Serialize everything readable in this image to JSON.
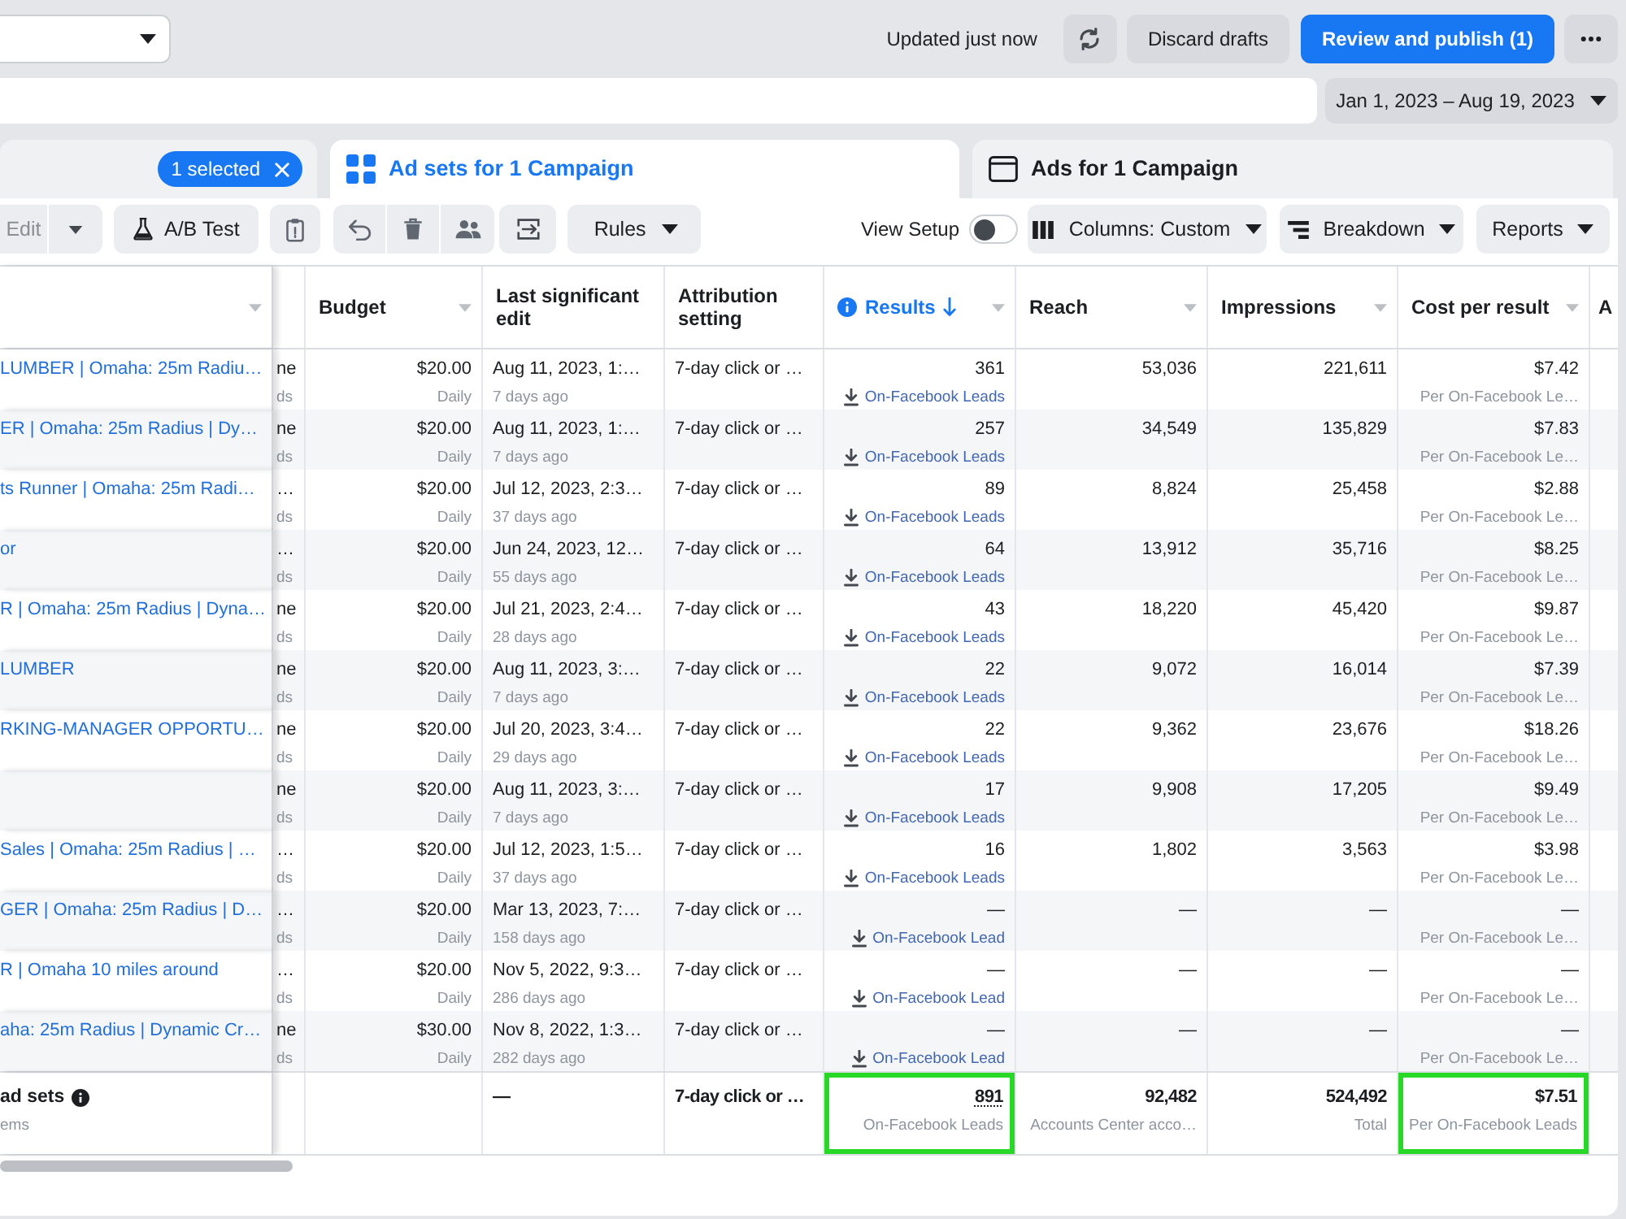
{
  "top_bar": {
    "status": "Updated just now",
    "discard_button": "Discard drafts",
    "publish_button": "Review and publish (1)"
  },
  "filter_bar": {
    "date_range": "Jan 1, 2023 – Aug 19, 2023"
  },
  "tabs": [
    {
      "badge": "1 selected",
      "selected": false
    },
    {
      "label": "Ad sets for 1 Campaign",
      "selected": true
    },
    {
      "label": "Ads for 1 Campaign",
      "selected": false
    }
  ],
  "toolbar": {
    "edit_button": {
      "label": "Edit",
      "disabled": true
    },
    "ab_test_button": "A/B Test",
    "rules_button": "Rules",
    "view_setup": {
      "label": "View Setup",
      "on": false
    },
    "columns_button": "Columns: Custom",
    "breakdown_button": "Breakdown",
    "reports_button": "Reports"
  },
  "table": {
    "columns": [
      {
        "sortable": true,
        "sorted": false
      },
      {
        "sortable": false,
        "sorted": false
      },
      {
        "label": "Budget",
        "sortable": true,
        "sorted": false
      },
      {
        "label": "Last significant edit",
        "sortable": false,
        "sorted": false
      },
      {
        "label": "Attribution setting",
        "sortable": false,
        "sorted": false
      },
      {
        "label": "Results",
        "info": true,
        "sortable": true,
        "sorted": true
      },
      {
        "label": "Reach",
        "sortable": true,
        "sorted": false
      },
      {
        "label": "Impressions",
        "sortable": true,
        "sorted": false
      },
      {
        "label": "Cost per result",
        "sortable": true,
        "sorted": false
      },
      {
        "label": "A",
        "sortable": false,
        "sorted": false
      }
    ],
    "rows": [
      {
        "name": "LUMBER | Omaha: 25m Radiu…",
        "column_2": {
          "value": "ne",
          "sub": "ds"
        },
        "budget": {
          "value": "$20.00",
          "sub": "Daily"
        },
        "last_edit": {
          "value": "Aug 11, 2023, 1:…",
          "sub": "7 days ago"
        },
        "attribution": "7-day click or …",
        "results": {
          "value": "361",
          "sub": "On-Facebook Leads"
        },
        "reach": "53,036",
        "impressions": "221,611",
        "cost_per_result": {
          "value": "$7.42",
          "sub": "Per On-Facebook Le…"
        }
      },
      {
        "name": "ER | Omaha: 25m Radius | Dy…",
        "column_2": {
          "value": "ne",
          "sub": "ds"
        },
        "budget": {
          "value": "$20.00",
          "sub": "Daily"
        },
        "last_edit": {
          "value": "Aug 11, 2023, 1:…",
          "sub": "7 days ago"
        },
        "attribution": "7-day click or …",
        "results": {
          "value": "257",
          "sub": "On-Facebook Leads"
        },
        "reach": "34,549",
        "impressions": "135,829",
        "cost_per_result": {
          "value": "$7.83",
          "sub": "Per On-Facebook Le…"
        }
      },
      {
        "name": "ts Runner | Omaha: 25m Radi…",
        "column_2": {
          "value": "…",
          "sub": "ds"
        },
        "budget": {
          "value": "$20.00",
          "sub": "Daily"
        },
        "last_edit": {
          "value": "Jul 12, 2023, 2:3…",
          "sub": "37 days ago"
        },
        "attribution": "7-day click or …",
        "results": {
          "value": "89",
          "sub": "On-Facebook Leads"
        },
        "reach": "8,824",
        "impressions": "25,458",
        "cost_per_result": {
          "value": "$2.88",
          "sub": "Per On-Facebook Le…"
        }
      },
      {
        "name": "or",
        "column_2": {
          "value": "…",
          "sub": "ds"
        },
        "budget": {
          "value": "$20.00",
          "sub": "Daily"
        },
        "last_edit": {
          "value": "Jun 24, 2023, 12…",
          "sub": "55 days ago"
        },
        "attribution": "7-day click or …",
        "results": {
          "value": "64",
          "sub": "On-Facebook Leads"
        },
        "reach": "13,912",
        "impressions": "35,716",
        "cost_per_result": {
          "value": "$8.25",
          "sub": "Per On-Facebook Le…"
        }
      },
      {
        "name": "R | Omaha: 25m Radius | Dyna…",
        "column_2": {
          "value": "ne",
          "sub": "ds"
        },
        "budget": {
          "value": "$20.00",
          "sub": "Daily"
        },
        "last_edit": {
          "value": "Jul 21, 2023, 2:4…",
          "sub": "28 days ago"
        },
        "attribution": "7-day click or …",
        "results": {
          "value": "43",
          "sub": "On-Facebook Leads"
        },
        "reach": "18,220",
        "impressions": "45,420",
        "cost_per_result": {
          "value": "$9.87",
          "sub": "Per On-Facebook Le…"
        }
      },
      {
        "name": "LUMBER",
        "column_2": {
          "value": "ne",
          "sub": "ds"
        },
        "budget": {
          "value": "$20.00",
          "sub": "Daily"
        },
        "last_edit": {
          "value": "Aug 11, 2023, 3:…",
          "sub": "7 days ago"
        },
        "attribution": "7-day click or …",
        "results": {
          "value": "22",
          "sub": "On-Facebook Leads"
        },
        "reach": "9,072",
        "impressions": "16,014",
        "cost_per_result": {
          "value": "$7.39",
          "sub": "Per On-Facebook Le…"
        }
      },
      {
        "name": "RKING-MANAGER OPPORTU…",
        "column_2": {
          "value": "ne",
          "sub": "ds"
        },
        "budget": {
          "value": "$20.00",
          "sub": "Daily"
        },
        "last_edit": {
          "value": "Jul 20, 2023, 3:4…",
          "sub": "29 days ago"
        },
        "attribution": "7-day click or …",
        "results": {
          "value": "22",
          "sub": "On-Facebook Leads"
        },
        "reach": "9,362",
        "impressions": "23,676",
        "cost_per_result": {
          "value": "$18.26",
          "sub": "Per On-Facebook Le…"
        }
      },
      {
        "column_2": {
          "value": "ne",
          "sub": "ds"
        },
        "budget": {
          "value": "$20.00",
          "sub": "Daily"
        },
        "last_edit": {
          "value": "Aug 11, 2023, 3:…",
          "sub": "7 days ago"
        },
        "attribution": "7-day click or …",
        "results": {
          "value": "17",
          "sub": "On-Facebook Leads"
        },
        "reach": "9,908",
        "impressions": "17,205",
        "cost_per_result": {
          "value": "$9.49",
          "sub": "Per On-Facebook Le…"
        }
      },
      {
        "name": "Sales | Omaha: 25m Radius | …",
        "column_2": {
          "value": "…",
          "sub": "ds"
        },
        "budget": {
          "value": "$20.00",
          "sub": "Daily"
        },
        "last_edit": {
          "value": "Jul 12, 2023, 1:5…",
          "sub": "37 days ago"
        },
        "attribution": "7-day click or …",
        "results": {
          "value": "16",
          "sub": "On-Facebook Leads"
        },
        "reach": "1,802",
        "impressions": "3,563",
        "cost_per_result": {
          "value": "$3.98",
          "sub": "Per On-Facebook Le…"
        }
      },
      {
        "name": "GER | Omaha: 25m Radius | D…",
        "column_2": {
          "value": "…",
          "sub": "ds"
        },
        "budget": {
          "value": "$20.00",
          "sub": "Daily"
        },
        "last_edit": {
          "value": "Mar 13, 2023, 7:…",
          "sub": "158 days ago"
        },
        "attribution": "7-day click or …",
        "results": {
          "value": "—",
          "sub": "On-Facebook Lead"
        },
        "reach": "—",
        "impressions": "—",
        "cost_per_result": {
          "value": "—",
          "sub": "Per On-Facebook Le…"
        }
      },
      {
        "name": "R | Omaha 10 miles around",
        "column_2": {
          "value": "…",
          "sub": "ds"
        },
        "budget": {
          "value": "$20.00",
          "sub": "Daily"
        },
        "last_edit": {
          "value": "Nov 5, 2022, 9:3…",
          "sub": "286 days ago"
        },
        "attribution": "7-day click or …",
        "results": {
          "value": "—",
          "sub": "On-Facebook Lead"
        },
        "reach": "—",
        "impressions": "—",
        "cost_per_result": {
          "value": "—",
          "sub": "Per On-Facebook Le…"
        }
      },
      {
        "name": "aha: 25m Radius | Dynamic Cr…",
        "column_2": {
          "value": "ne",
          "sub": "ds"
        },
        "budget": {
          "value": "$30.00",
          "sub": "Daily"
        },
        "last_edit": {
          "value": "Nov 8, 2022, 1:3…",
          "sub": "282 days ago"
        },
        "attribution": "7-day click or …",
        "results": {
          "value": "—",
          "sub": "On-Facebook Lead"
        },
        "reach": "—",
        "impressions": "—",
        "cost_per_result": {
          "value": "—",
          "sub": "Per On-Facebook Le…"
        }
      }
    ],
    "footer": {
      "name": {
        "value": "ad sets",
        "sub": "ems"
      },
      "last_edit": "—",
      "attribution": "7-day click or …",
      "results": {
        "value": "891",
        "sub": "On-Facebook Leads",
        "highlighted": true
      },
      "reach": {
        "value": "92,482",
        "sub": "Accounts Center acco…"
      },
      "impressions": {
        "value": "524,492",
        "sub": "Total"
      },
      "cost_per_result": {
        "value": "$7.51",
        "sub": "Per On-Facebook Leads",
        "highlighted": true
      }
    }
  }
}
